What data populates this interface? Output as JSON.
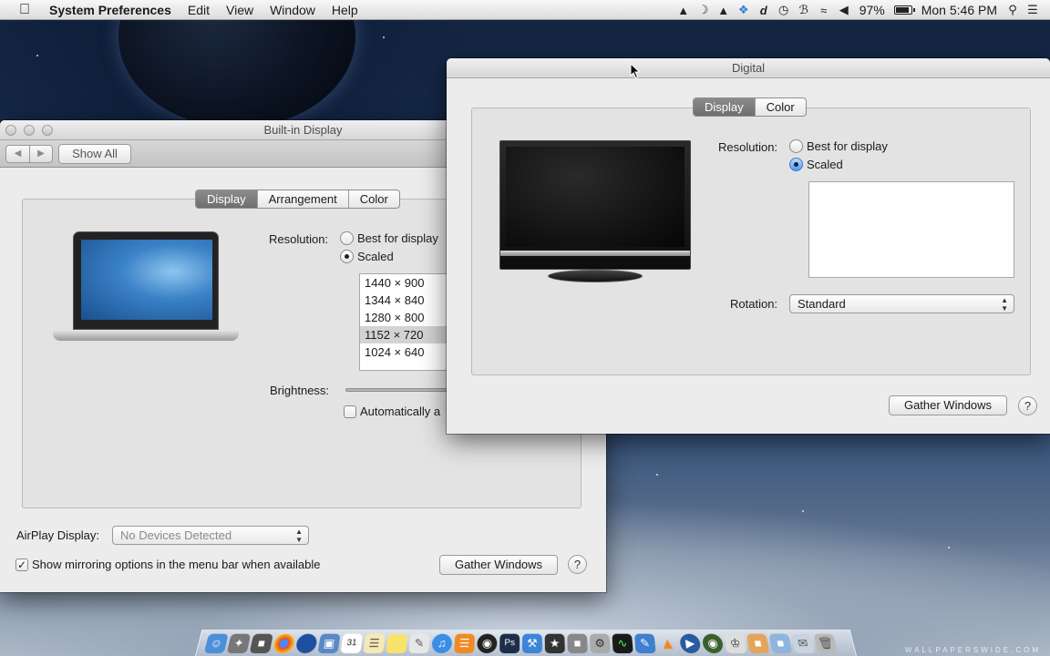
{
  "menubar": {
    "app_name": "System Preferences",
    "menus": [
      "Edit",
      "View",
      "Window",
      "Help"
    ],
    "battery_percent": "97%",
    "clock": "Mon 5:46 PM",
    "status_icons": [
      "google-drive-icon",
      "time-machine-icon",
      "drive-icon",
      "dropbox-icon",
      "dashlane-icon",
      "clock-icon",
      "bluetooth-icon",
      "wifi-icon",
      "volume-icon"
    ]
  },
  "builtin_window": {
    "title": "Built-in Display",
    "toolbar": {
      "show_all": "Show All"
    },
    "tabs": [
      "Display",
      "Arrangement",
      "Color"
    ],
    "selected_tab": "Display",
    "resolution_label": "Resolution:",
    "options": {
      "best": "Best for display",
      "scaled": "Scaled"
    },
    "selected_option": "Scaled",
    "resolutions": [
      "1440 × 900",
      "1344 × 840",
      "1280 × 800",
      "1152 × 720",
      "1024 × 640"
    ],
    "selected_resolution": "1152 × 720",
    "brightness_label": "Brightness:",
    "auto_brightness_label": "Automatically a",
    "airplay_label": "AirPlay Display:",
    "airplay_value": "No Devices Detected",
    "mirroring_label": "Show mirroring options in the menu bar when available",
    "mirroring_checked": true,
    "gather_windows": "Gather Windows",
    "help": "?"
  },
  "digital_window": {
    "title": "Digital",
    "tabs": [
      "Display",
      "Color"
    ],
    "selected_tab": "Display",
    "resolution_label": "Resolution:",
    "options": {
      "best": "Best for display",
      "scaled": "Scaled"
    },
    "selected_option": "Scaled",
    "rotation_label": "Rotation:",
    "rotation_value": "Standard",
    "gather_windows": "Gather Windows",
    "help": "?"
  },
  "dock": {
    "icons": [
      "finder-icon",
      "launchpad-icon",
      "app-store-icon",
      "chrome-icon",
      "firefox-icon",
      "preview-icon",
      "calendar-icon",
      "notes-icon",
      "stickies-icon",
      "textedit-icon",
      "itunes-icon",
      "ibooks-icon",
      "aperture-icon",
      "photoshop-icon",
      "xcode-icon",
      "final-cut-icon",
      "quicktime-icon",
      "utility-icon",
      "activity-monitor-icon",
      "pages-icon",
      "vlc-icon",
      "quicktime-player-icon",
      "steam-icon",
      "automator-icon",
      "applications-folder-icon",
      "documents-folder-icon",
      "downloads-folder-icon",
      "trash-icon"
    ]
  },
  "watermark": "WALLPAPERSWIDE.COM",
  "colors": {
    "accent_blue": "#3b7bc0",
    "selected_tab": "#7a7a7a"
  }
}
